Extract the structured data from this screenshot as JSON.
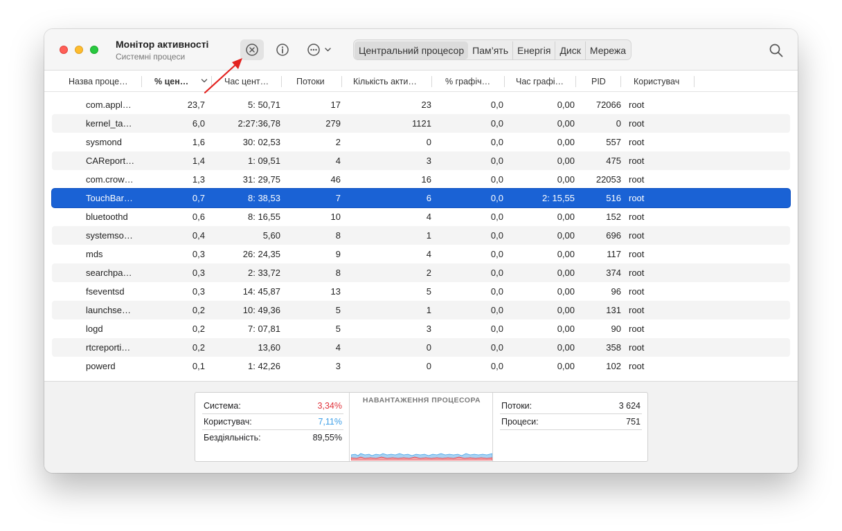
{
  "window": {
    "title": "Монітор активності",
    "subtitle": "Системні процеси"
  },
  "toolbar": {
    "stop_icon": "stop-process-icon",
    "info_icon": "info-icon",
    "more_icon": "more-options-icon",
    "search_icon": "search-icon",
    "tabs": [
      {
        "label": "Центральний процесор",
        "active": true
      },
      {
        "label": "Пам’ять",
        "active": false
      },
      {
        "label": "Енергія",
        "active": false
      },
      {
        "label": "Диск",
        "active": false
      },
      {
        "label": "Мережа",
        "active": false
      }
    ]
  },
  "table": {
    "columns": [
      "Назва проце…",
      "% цен…",
      "Час цент…",
      "Потоки",
      "Кількість акти…",
      "% графіч…",
      "Час графі…",
      "PID",
      "Користувач"
    ],
    "rows": [
      [
        "com.appl…",
        "23,7",
        "5: 50,71",
        "17",
        "23",
        "0,0",
        "0,00",
        "72066",
        "root"
      ],
      [
        "kernel_ta…",
        "6,0",
        "2:27:36,78",
        "279",
        "1121",
        "0,0",
        "0,00",
        "0",
        "root"
      ],
      [
        "sysmond",
        "1,6",
        "30: 02,53",
        "2",
        "0",
        "0,0",
        "0,00",
        "557",
        "root"
      ],
      [
        "CAReport…",
        "1,4",
        "1: 09,51",
        "4",
        "3",
        "0,0",
        "0,00",
        "475",
        "root"
      ],
      [
        "com.crow…",
        "1,3",
        "31: 29,75",
        "46",
        "16",
        "0,0",
        "0,00",
        "22053",
        "root"
      ],
      [
        "TouchBar…",
        "0,7",
        "8: 38,53",
        "7",
        "6",
        "0,0",
        "2: 15,55",
        "516",
        "root"
      ],
      [
        "bluetoothd",
        "0,6",
        "8: 16,55",
        "10",
        "4",
        "0,0",
        "0,00",
        "152",
        "root"
      ],
      [
        "systemso…",
        "0,4",
        "5,60",
        "8",
        "1",
        "0,0",
        "0,00",
        "696",
        "root"
      ],
      [
        "mds",
        "0,3",
        "26: 24,35",
        "9",
        "4",
        "0,0",
        "0,00",
        "117",
        "root"
      ],
      [
        "searchpa…",
        "0,3",
        "2: 33,72",
        "8",
        "2",
        "0,0",
        "0,00",
        "374",
        "root"
      ],
      [
        "fseventsd",
        "0,3",
        "14: 45,87",
        "13",
        "5",
        "0,0",
        "0,00",
        "96",
        "root"
      ],
      [
        "launchse…",
        "0,2",
        "10: 49,36",
        "5",
        "1",
        "0,0",
        "0,00",
        "131",
        "root"
      ],
      [
        "logd",
        "0,2",
        "7: 07,81",
        "5",
        "3",
        "0,0",
        "0,00",
        "90",
        "root"
      ],
      [
        "rtcreporti…",
        "0,2",
        "13,60",
        "4",
        "0",
        "0,0",
        "0,00",
        "358",
        "root"
      ],
      [
        "powerd",
        "0,1",
        "1: 42,26",
        "3",
        "0",
        "0,0",
        "0,00",
        "102",
        "root"
      ]
    ],
    "selected_row": 5
  },
  "summary": {
    "left": [
      {
        "label": "Система:",
        "value": "3,34%",
        "color": "#e0313a"
      },
      {
        "label": "Користувач:",
        "value": "7,11%",
        "color": "#3c9ee7"
      },
      {
        "label": "Бездіяльність:",
        "value": "89,55%",
        "color": "#1d1d1f"
      }
    ],
    "graph_title": "НАВАНТАЖЕННЯ ПРОЦЕСОРА",
    "right": [
      {
        "label": "Потоки:",
        "value": "3 624"
      },
      {
        "label": "Процеси:",
        "value": "751"
      }
    ]
  }
}
